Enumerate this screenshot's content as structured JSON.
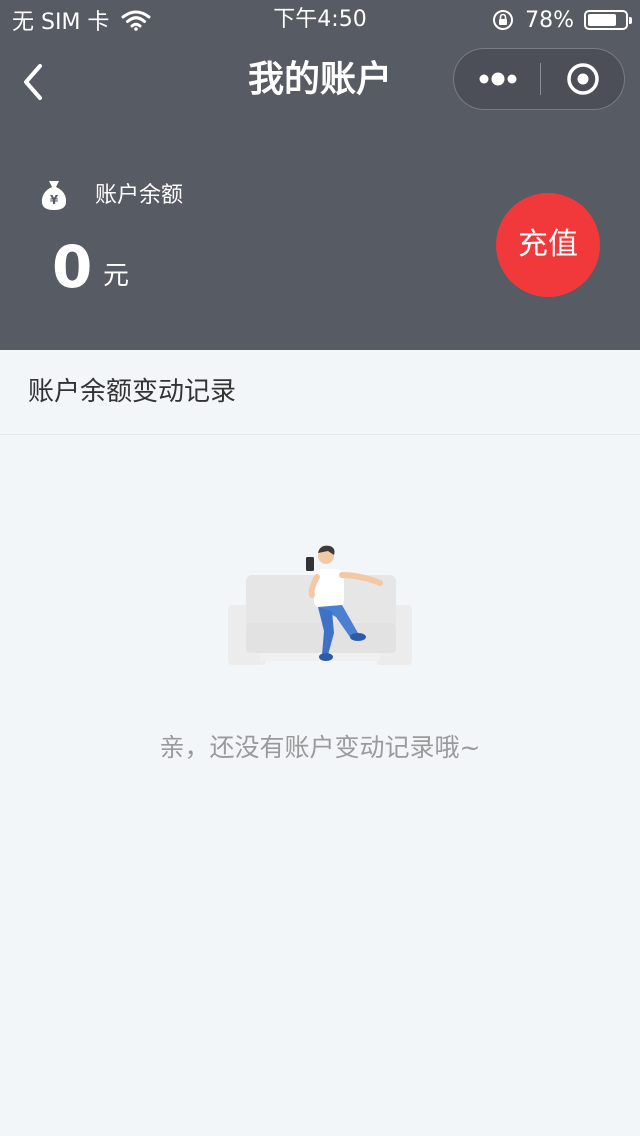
{
  "status_bar": {
    "carrier": "无 SIM 卡",
    "time": "下午4:50",
    "battery_percent": "78%",
    "battery_level": 0.78,
    "icons": [
      "wifi-icon",
      "orientation-lock-icon",
      "battery-icon"
    ]
  },
  "nav": {
    "title": "我的账户",
    "icons": [
      "back-chevron-icon",
      "more-dots-icon",
      "close-target-icon"
    ]
  },
  "balance": {
    "label": "账户余额",
    "amount": "0",
    "unit": "元",
    "icon": "money-bag-yen-icon"
  },
  "recharge": {
    "label": "充值"
  },
  "records": {
    "title": "账户余额变动记录",
    "empty_text": "亲，还没有账户变动记录哦~",
    "illustration": "person-on-sofa-illustration"
  },
  "colors": {
    "header_bg": "#575b63",
    "page_bg": "#f3f6f9",
    "accent_red": "#f1393b",
    "text_dark": "#333333",
    "text_muted": "#9a9a9a"
  }
}
